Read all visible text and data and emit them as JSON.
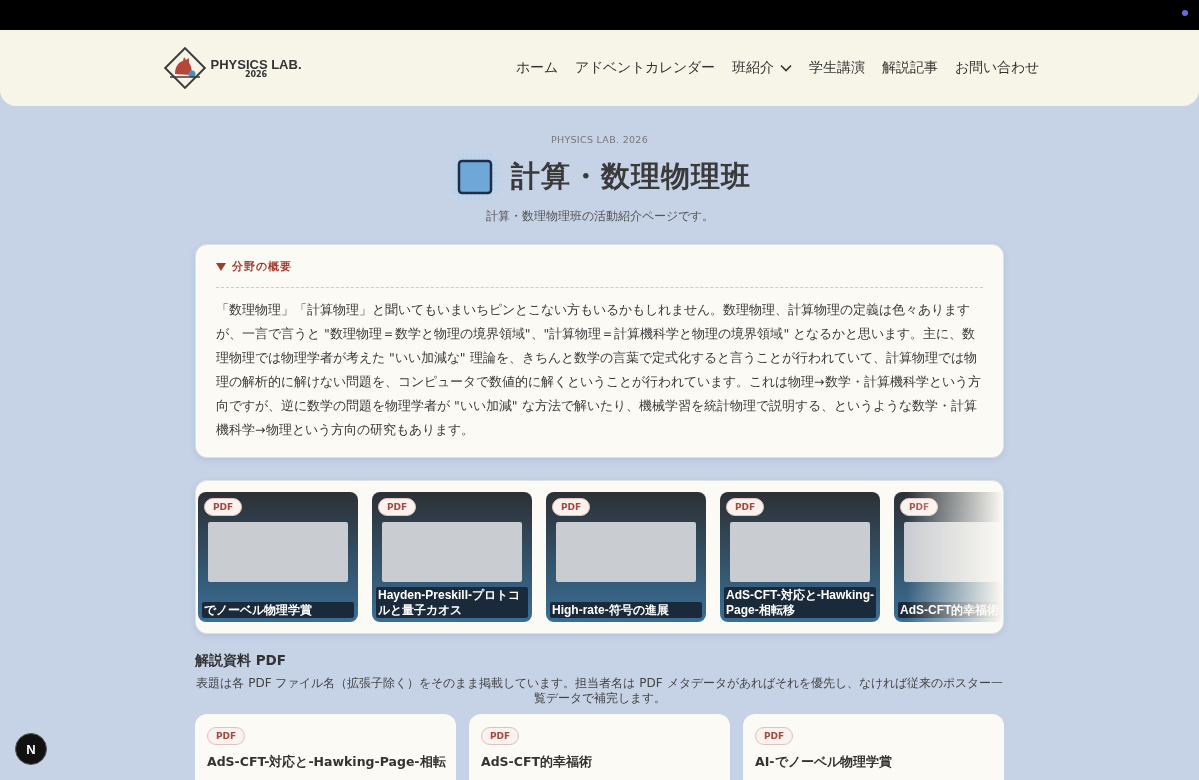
{
  "header": {
    "logo": {
      "name": "PHYSICS LAB.",
      "year": "2026"
    },
    "nav": [
      {
        "label": "ホーム",
        "has_menu": false
      },
      {
        "label": "アドベントカレンダー",
        "has_menu": false
      },
      {
        "label": "班紹介",
        "has_menu": true
      },
      {
        "label": "学生講演",
        "has_menu": false
      },
      {
        "label": "解説記事",
        "has_menu": false
      },
      {
        "label": "お問い合わせ",
        "has_menu": false
      }
    ]
  },
  "hero": {
    "eyebrow": "PHYSICS LAB. 2026",
    "title": "計算・数理物理班",
    "subtitle": "計算・数理物理班の活動紹介ページです。"
  },
  "overview": {
    "summary": "分野の概要",
    "expanded": true,
    "text": "「数理物理」「計算物理」と聞いてもいまいちピンとこない方もいるかもしれません。数理物理、計算物理の定義は色々ありますが、一言で言うと \"数理物理＝数学と物理の境界領域\"、\"計算物理＝計算機科学と物理の境界領域\" となるかと思います。主に、数理物理では物理学者が考えた \"いい加減な\" 理論を、きちんと数学の言葉で定式化すると言うことが行われていて、計算物理では物理の解析的に解けない問題を、コンピュータで数値的に解くということが行われています。これは物理→数学・計算機科学という方向ですが、逆に数学の問題を物理学者が \"いい加減\" な方法で解いたり、機械学習を統計物理で説明する、というような数学・計算機科学→物理という方向の研究もあります。"
  },
  "carousel": [
    {
      "badge": "PDF",
      "caption": "でノーベル物理学賞"
    },
    {
      "badge": "PDF",
      "caption": "Hayden-Preskill-プロトコルと量子カオス"
    },
    {
      "badge": "PDF",
      "caption": "High-rate-符号の進展"
    },
    {
      "badge": "PDF",
      "caption": "AdS-CFT-対応と-Hawking-Page-相転移"
    },
    {
      "badge": "PDF",
      "caption": "AdS-CFT的幸福術"
    }
  ],
  "pdf_section": {
    "heading": "解説資料 PDF",
    "note": "表題は各 PDF ファイル名（拡張子除く）をそのまま掲載しています。担当者名は PDF メタデータがあればそれを優先し、なければ従来のポスター一覧データで補完します。",
    "cards": [
      {
        "badge": "PDF",
        "title": "AdS-CFT-対応と-Hawking-Page-相転"
      },
      {
        "badge": "PDF",
        "title": "AdS-CFT的幸福術"
      },
      {
        "badge": "PDF",
        "title": "AI-でノーベル物理学賞"
      }
    ]
  },
  "dev_badge": {
    "label": "N"
  }
}
